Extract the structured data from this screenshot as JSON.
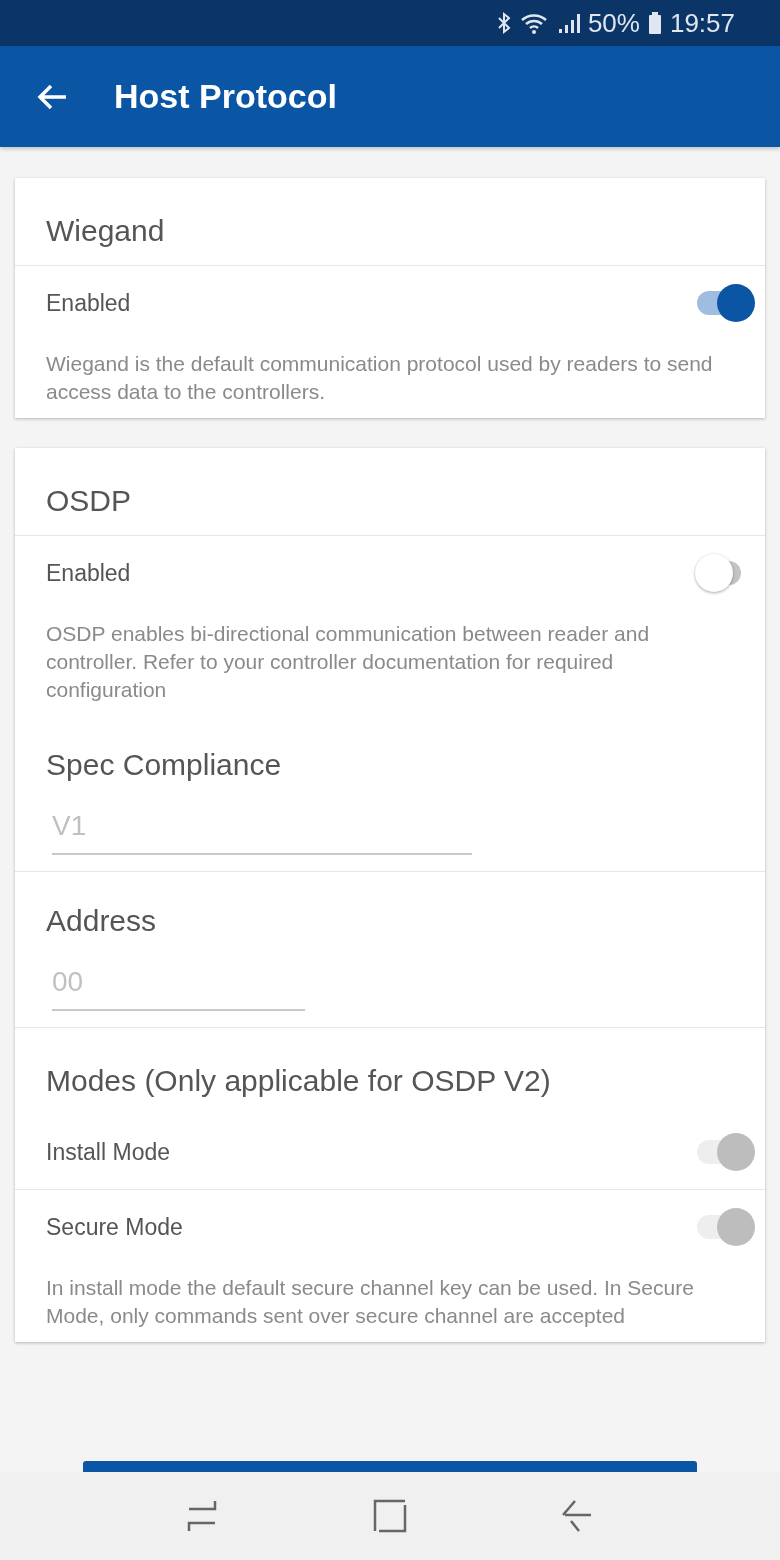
{
  "status_bar": {
    "battery": "50%",
    "time": "19:57"
  },
  "app_bar": {
    "title": "Host Protocol"
  },
  "cards": [
    {
      "items": [
        {
          "kind": "header",
          "text": "Wiegand"
        },
        {
          "kind": "divider"
        },
        {
          "kind": "toggle",
          "label": "Enabled",
          "on": true,
          "disabled": false
        },
        {
          "kind": "note",
          "text": "Wiegand is the default communication protocol used by readers to send access data to the controllers."
        }
      ]
    },
    {
      "items": [
        {
          "kind": "header",
          "text": "OSDP"
        },
        {
          "kind": "divider"
        },
        {
          "kind": "toggle",
          "label": "Enabled",
          "on": false,
          "disabled": false
        },
        {
          "kind": "note",
          "text": "OSDP enables bi-directional communication between reader and controller. Refer to your controller documentation for required configuration"
        },
        {
          "kind": "field",
          "label": "Spec Compliance",
          "value": "V1"
        },
        {
          "kind": "divider"
        },
        {
          "kind": "field",
          "label": "Address",
          "value": "00"
        },
        {
          "kind": "divider"
        },
        {
          "kind": "header",
          "text": "Modes (Only applicable for OSDP V2)"
        },
        {
          "kind": "toggle",
          "label": "Install Mode",
          "on": true,
          "disabled": true
        },
        {
          "kind": "divider"
        },
        {
          "kind": "toggle",
          "label": "Secure Mode",
          "on": true,
          "disabled": true
        },
        {
          "kind": "note",
          "text": "In install mode the default secure channel key can be used. In Secure Mode, only commands sent over secure channel are accepted"
        }
      ]
    }
  ]
}
